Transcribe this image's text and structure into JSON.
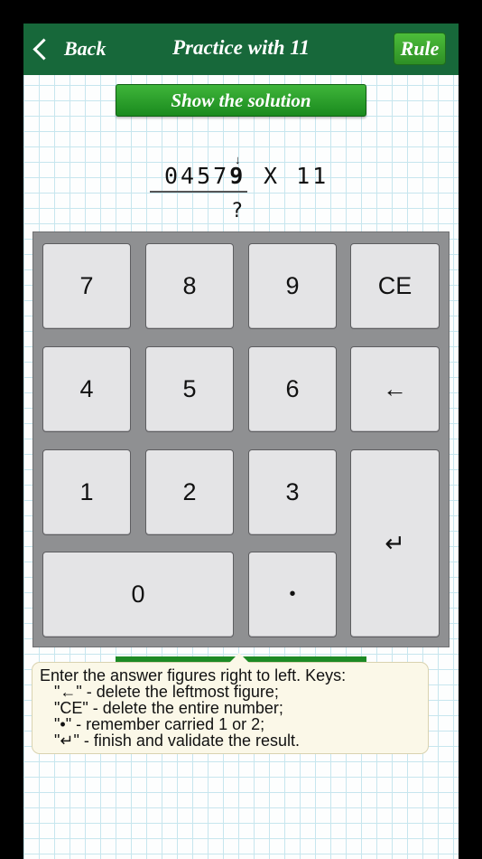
{
  "header": {
    "back_label": "Back",
    "title": "Practice with 11",
    "rule_label": "Rule"
  },
  "solution_button": "Show the solution",
  "problem": {
    "multiplicand_prefix": "0457",
    "multiplicand_active": "9",
    "operator_multiplier": "X 11",
    "answer": "?"
  },
  "keypad": {
    "k7": "7",
    "k8": "8",
    "k9": "9",
    "kce": "CE",
    "k4": "4",
    "k5": "5",
    "k6": "6",
    "kback": "←",
    "k1": "1",
    "k2": "2",
    "k3": "3",
    "kenter": "↵",
    "k0": "0",
    "kdot": "•"
  },
  "tooltip": {
    "line1": "Enter the answer figures right to left. Keys:",
    "line2": "\"←\" - delete the leftmost figure;",
    "line3": "\"CE\" - delete the entire number;",
    "line4": "\"•\" - remember carried 1 or 2;",
    "line5": "\"↵\" - finish and validate the result."
  }
}
